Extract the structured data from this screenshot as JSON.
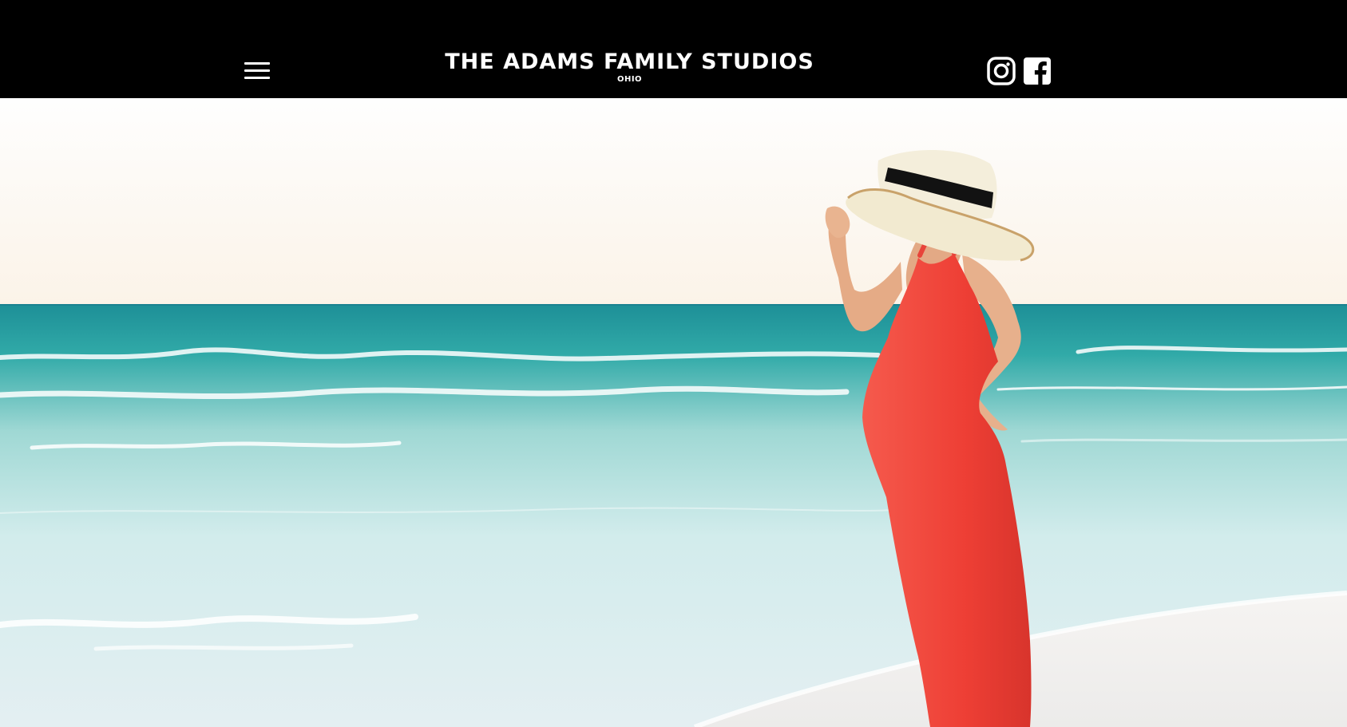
{
  "header": {
    "brand_title": "THE ADAMS FAMILY STUDIOS",
    "brand_subtitle": "OHIO",
    "menu_icon": "hamburger-menu-icon",
    "social": [
      {
        "icon": "instagram-icon",
        "name": "Instagram"
      },
      {
        "icon": "facebook-icon",
        "name": "Facebook"
      }
    ]
  },
  "hero": {
    "description_icon": "photo",
    "colors": {
      "sky": "#fbf6ee",
      "sea_far": "#2aa7a6",
      "sea_near": "#cfe9ea",
      "sand": "#f3f1ee",
      "dress": "#f0483e",
      "hat": "#f3ecd6",
      "hat_band": "#111111"
    }
  },
  "colors": {
    "header_bg": "#000000",
    "header_text": "#ffffff"
  }
}
